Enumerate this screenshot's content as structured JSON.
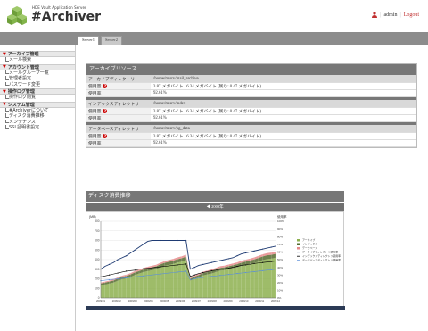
{
  "header": {
    "logo_sub": "HDE Vault Application Server",
    "logo_main": "#Archiver",
    "user": "admin",
    "separator": "|",
    "logout": "Logout"
  },
  "tabs": [
    {
      "label": "Server1",
      "active": true
    },
    {
      "label": "Server2",
      "active": false
    }
  ],
  "sidebar": [
    {
      "title": "アーカイブ管理",
      "items": [
        "メール検索"
      ]
    },
    {
      "title": "アカウント管理",
      "items": [
        "メールグループ一覧",
        "管理者設定",
        "パスワード変更"
      ]
    },
    {
      "title": "操作ログ管理",
      "items": [
        "操作ログ閲覧"
      ]
    },
    {
      "title": "システム管理",
      "items": [
        "#Archiverについて",
        "ディスク消費推移",
        "メンテナンス",
        "SSL証明書設定"
      ]
    }
  ],
  "panel": {
    "title": "アーカイブリソース",
    "sections": [
      {
        "dir_label": "アーカイブディレクトリ",
        "dir_value": "/home/misrv/mail_archive",
        "usage_label": "使用量",
        "usage_value": "3.87 メガバイト / 6.34 メガバイト (残り: 0.47 メガバイト)",
        "rate_label": "使用率",
        "rate_value": "92.61%"
      },
      {
        "dir_label": "インデックスディレクトリ",
        "dir_value": "/home/misrv/index",
        "usage_label": "使用量",
        "usage_value": "3.87 メガバイト / 6.34 メガバイト (残り: 0.47 メガバイト)",
        "rate_label": "使用率",
        "rate_value": "92.61%"
      },
      {
        "dir_label": "データベースディレクトリ",
        "dir_value": "/home/misrv/pg_data",
        "usage_label": "使用量",
        "usage_value": "3.87 メガバイト / 6.34 メガバイト (残り: 0.47 メガバイト)",
        "rate_label": "使用率",
        "rate_value": "92.61%"
      }
    ]
  },
  "chart_section": {
    "title": "ディスク消費推移",
    "nav_label": "2009年"
  },
  "chart_data": {
    "type": "area",
    "title": "",
    "ylabel_left": "(MB)",
    "ylabel_right": "使用率",
    "ylim": [
      0,
      800
    ],
    "y_ticks": [
      0,
      100,
      200,
      300,
      400,
      500,
      600,
      700,
      800
    ],
    "y2_ticks": [
      "0%",
      "10%",
      "20%",
      "30%",
      "40%",
      "50%",
      "60%",
      "70%",
      "80%",
      "90%",
      "100%"
    ],
    "x_ticks": [
      "2009/01",
      "2009/02",
      "2009/03",
      "2009/04",
      "2009/05",
      "2009/06",
      "2009/07",
      "2009/08",
      "2009/09",
      "2009/10",
      "2009/11",
      "2009/12"
    ],
    "series": [
      {
        "name": "アーカイブ",
        "color": "#8db04f",
        "values": [
          130,
          140,
          150,
          160,
          180,
          195,
          205,
          220,
          240,
          255,
          270,
          280,
          290,
          300,
          320,
          335,
          345,
          355,
          370,
          380,
          395,
          180,
          200,
          215,
          235,
          245,
          255,
          270,
          285,
          290,
          300,
          310,
          320,
          335,
          345,
          355,
          365,
          380,
          395,
          405,
          410,
          420
        ]
      },
      {
        "name": "インデックス",
        "color": "#556b2f",
        "values": [
          20,
          20,
          21,
          22,
          23,
          24,
          25,
          25,
          26,
          27,
          28,
          29,
          30,
          30,
          31,
          32,
          33,
          34,
          34,
          35,
          36,
          20,
          22,
          24,
          25,
          26,
          27,
          28,
          29,
          30,
          31,
          32,
          33,
          34,
          35,
          36,
          37,
          38,
          39,
          40,
          40,
          41
        ]
      },
      {
        "name": "データベース",
        "color": "#e58a8a",
        "values": [
          10,
          11,
          11,
          12,
          12,
          13,
          13,
          14,
          14,
          15,
          15,
          16,
          16,
          17,
          17,
          18,
          18,
          19,
          19,
          20,
          20,
          12,
          13,
          14,
          15,
          15,
          16,
          16,
          17,
          17,
          18,
          18,
          19,
          19,
          20,
          20,
          21,
          21,
          22,
          22,
          23,
          23
        ]
      },
      {
        "name": "アーカイブディレクトリ使用率",
        "color": "#1f3b73",
        "values": [
          300,
          330,
          350,
          370,
          400,
          420,
          440,
          470,
          500,
          530,
          560,
          590,
          600,
          600,
          600,
          600,
          600,
          600,
          600,
          600,
          600,
          300,
          320,
          340,
          350,
          360,
          370,
          380,
          390,
          400,
          410,
          420,
          440,
          460,
          470,
          480,
          490,
          500,
          510,
          520,
          530,
          540
        ]
      },
      {
        "name": "インデックスディレクトリ使用率",
        "color": "#000000",
        "values": [
          220,
          230,
          240,
          250,
          260,
          270,
          280,
          285,
          290,
          300,
          305,
          310,
          315,
          320,
          325,
          330,
          335,
          340,
          345,
          350,
          355,
          225,
          240,
          255,
          265,
          275,
          285,
          290,
          300,
          305,
          310,
          320,
          330,
          340,
          345,
          350,
          360,
          365,
          370,
          375,
          380,
          385
        ]
      },
      {
        "name": "データベースディレクトリ使用率",
        "color": "#5b8fd9",
        "values": [
          180,
          185,
          190,
          195,
          200,
          205,
          210,
          215,
          220,
          225,
          230,
          235,
          240,
          245,
          250,
          255,
          260,
          265,
          270,
          275,
          280,
          190,
          200,
          210,
          215,
          220,
          225,
          230,
          235,
          240,
          245,
          250,
          255,
          260,
          265,
          270,
          275,
          280,
          285,
          290,
          295,
          300
        ]
      }
    ],
    "legend_position": "right"
  }
}
